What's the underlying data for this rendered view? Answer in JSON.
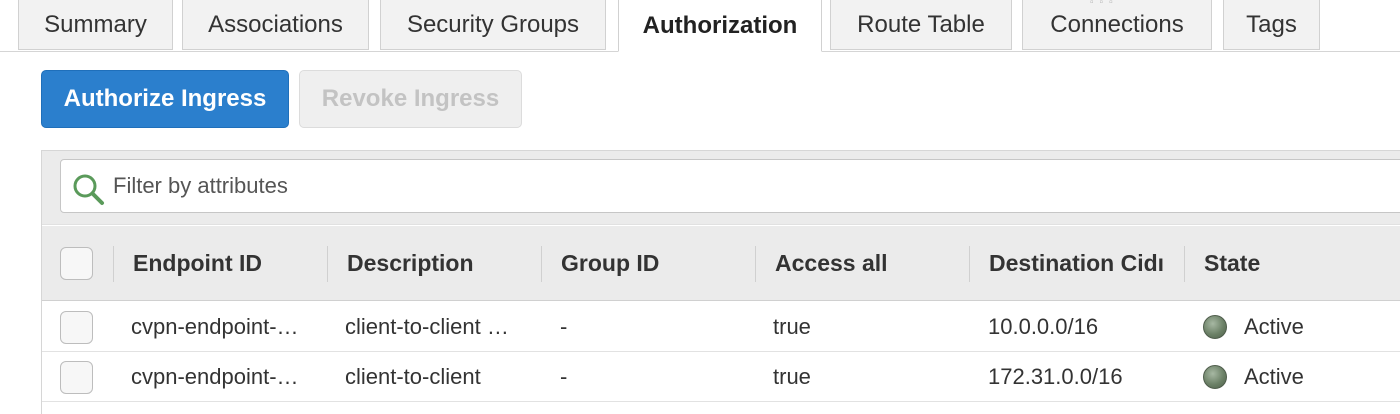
{
  "tabs": [
    {
      "label": "Summary",
      "active": false
    },
    {
      "label": "Associations",
      "active": false
    },
    {
      "label": "Security Groups",
      "active": false
    },
    {
      "label": "Authorization",
      "active": true
    },
    {
      "label": "Route Table",
      "active": false
    },
    {
      "label": "Connections",
      "active": false
    },
    {
      "label": "Tags",
      "active": false
    }
  ],
  "toolbar": {
    "authorize_label": "Authorize Ingress",
    "revoke_label": "Revoke Ingress"
  },
  "filter": {
    "placeholder": "Filter by attributes"
  },
  "table": {
    "columns": [
      "Endpoint ID",
      "Description",
      "Group ID",
      "Access all",
      "Destination Cidı",
      "State"
    ],
    "rows": [
      {
        "endpoint_id": "cvpn-endpoint-…",
        "description": "client-to-client …",
        "group_id": "-",
        "access_all": "true",
        "destination_cidr": "10.0.0.0/16",
        "state": "Active"
      },
      {
        "endpoint_id": "cvpn-endpoint-…",
        "description": "client-to-client",
        "group_id": "-",
        "access_all": "true",
        "destination_cidr": "172.31.0.0/16",
        "state": "Active"
      }
    ]
  },
  "colors": {
    "primary": "#2b7fcd",
    "state_active": "#6c8167"
  },
  "icons": {
    "filter": "search-icon",
    "state": "status-dot-icon"
  }
}
